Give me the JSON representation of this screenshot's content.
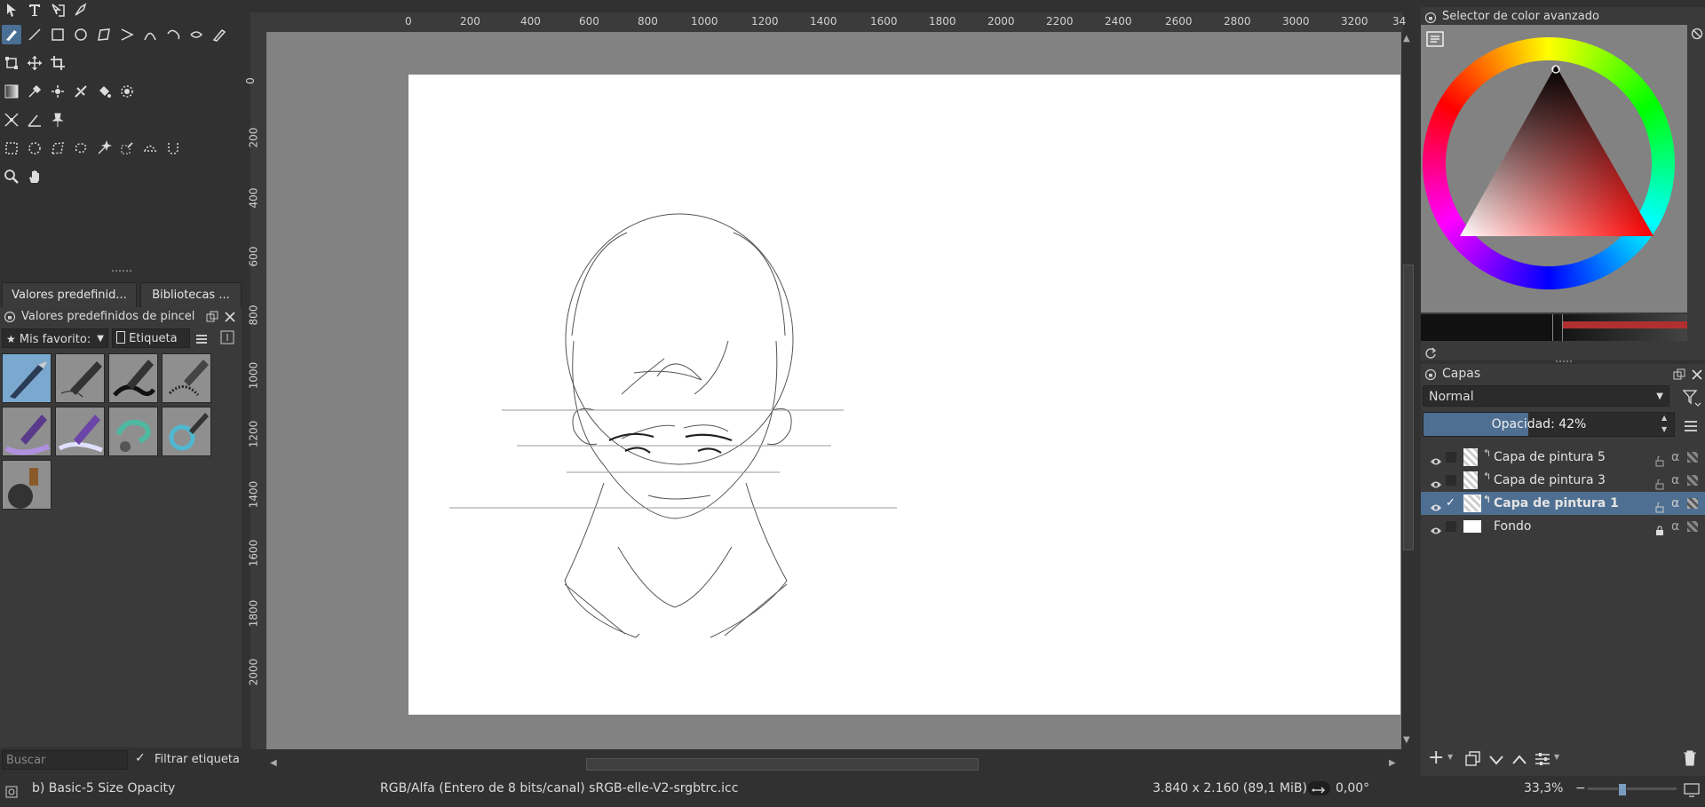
{
  "canvas": {
    "ruler_top": [
      "0",
      "200",
      "400",
      "600",
      "800",
      "1000",
      "1200",
      "1400",
      "1600",
      "1800",
      "2000",
      "2200",
      "2400",
      "2600",
      "2800",
      "3000",
      "3200",
      "34"
    ],
    "ruler_left": [
      "0",
      "200",
      "400",
      "600",
      "800",
      "1000",
      "1200",
      "1400",
      "1600",
      "1800",
      "2000"
    ]
  },
  "presets": {
    "tabs": [
      "Valores predefinid...",
      "Bibliotecas ..."
    ],
    "panel_title": "Valores predefinidos de pincel",
    "favorites_dropdown": "Mis favorito:",
    "tag_dropdown": "Etiqueta",
    "search_placeholder": "Buscar",
    "filter_tag_label": "Filtrar etiqueta"
  },
  "color": {
    "panel_title": "Selector de color avanzado",
    "accent": "#4e6f92"
  },
  "layers": {
    "panel_title": "Capas",
    "blend_mode": "Normal",
    "opacity_label": "Opacidad:  42%",
    "opacity_value": 42,
    "items": [
      {
        "name": "Capa de pintura 5",
        "selected": false
      },
      {
        "name": "Capa de pintura 3",
        "selected": false
      },
      {
        "name": "Capa de pintura 1",
        "selected": true
      },
      {
        "name": "Fondo",
        "selected": false
      }
    ]
  },
  "status": {
    "brush": "b) Basic-5 Size Opacity",
    "color_space": "RGB/Alfa (Entero de 8 bits/canal)  sRGB-elle-V2-srgbtrc.icc",
    "dimensions": "3.840 x 2.160 (89,1 MiB)",
    "rotation": "0,00°",
    "zoom": "33,3%"
  }
}
